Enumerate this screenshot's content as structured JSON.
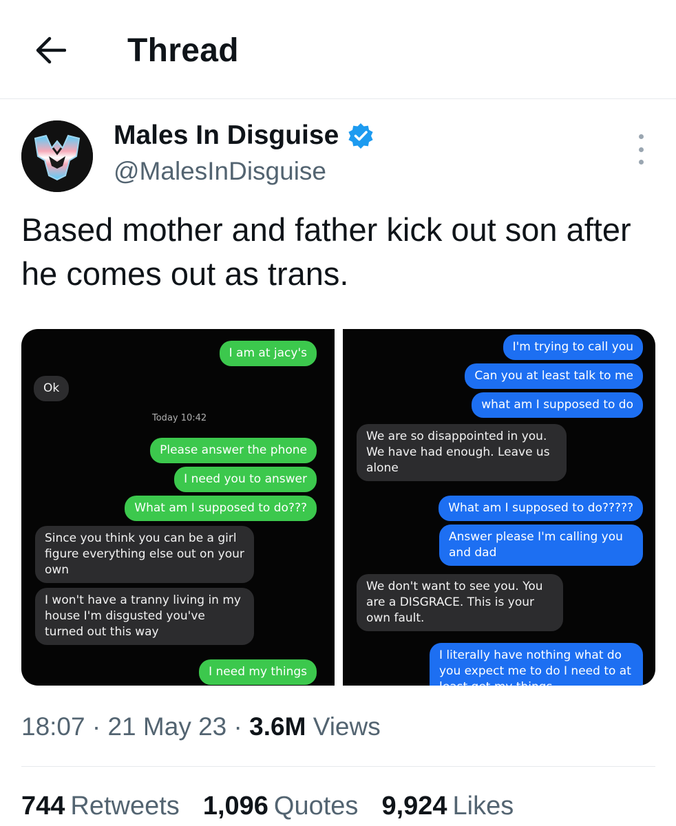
{
  "header": {
    "title": "Thread",
    "back_icon": "arrow-left-icon"
  },
  "author": {
    "name": "Males In Disguise",
    "handle": "@MalesInDisguise",
    "verified_color": "#1d9bf0"
  },
  "tweet": {
    "text": "Based mother and father kick out son after he comes out as trans."
  },
  "media": {
    "left": {
      "timestamp": "Today 10:42",
      "messages": [
        {
          "side": "sent",
          "text": "I am at jacy's"
        },
        {
          "side": "received",
          "text": "Ok"
        },
        {
          "side": "sent",
          "text": "Please answer the phone"
        },
        {
          "side": "sent",
          "text": "I need you to answer"
        },
        {
          "side": "sent",
          "text": "What am I supposed to do???"
        },
        {
          "side": "received",
          "text": "Since you think you can be a girl figure everything else out on your own"
        },
        {
          "side": "received",
          "text": "I won't have a tranny living in my house I'm disgusted you've turned out this way"
        },
        {
          "side": "sent",
          "text": "I need my things"
        }
      ]
    },
    "right": {
      "messages": [
        {
          "side": "sent",
          "text": "I'm trying to call you"
        },
        {
          "side": "sent",
          "text": "Can you at least talk to me"
        },
        {
          "side": "sent",
          "text": "what am I supposed to do"
        },
        {
          "side": "received",
          "text": "We are so disappointed in you. We have had enough. Leave us alone"
        },
        {
          "side": "sent",
          "text": "What am I supposed to do?????"
        },
        {
          "side": "sent",
          "text": "Answer please I'm calling you and dad"
        },
        {
          "side": "received",
          "text": "We don't want to see you. You are a DISGRACE. This is your own fault."
        },
        {
          "side": "sent",
          "text": "I literally have nothing what do you expect me to do I need to at least get my things"
        }
      ]
    }
  },
  "meta": {
    "time": "18:07",
    "separator": "·",
    "date": "21 May 23",
    "views_count": "3.6M",
    "views_label": "Views"
  },
  "stats": {
    "retweets_count": "744",
    "retweets_label": "Retweets",
    "quotes_count": "1,096",
    "quotes_label": "Quotes",
    "likes_count": "9,924",
    "likes_label": "Likes"
  }
}
